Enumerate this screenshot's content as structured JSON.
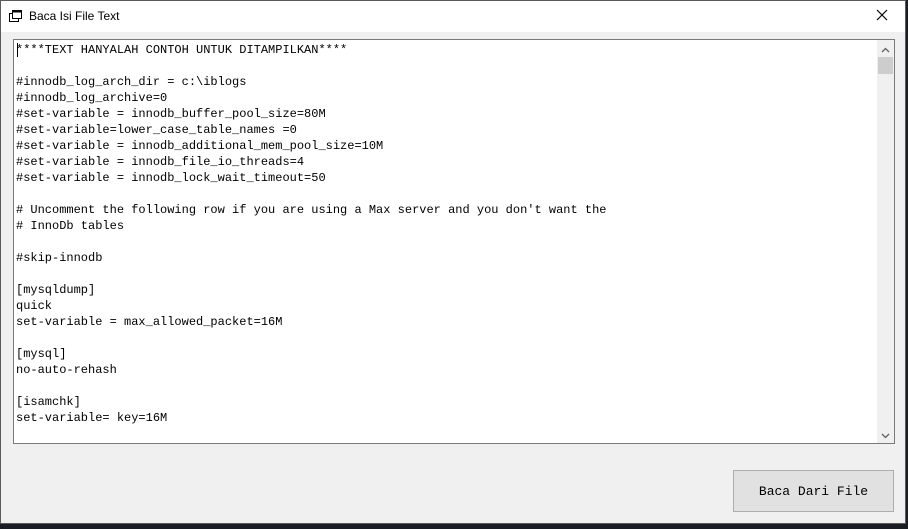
{
  "window": {
    "title": "Baca Isi File Text"
  },
  "editor": {
    "content": "****TEXT HANYALAH CONTOH UNTUK DITAMPILKAN****\n\n#innodb_log_arch_dir = c:\\iblogs\n#innodb_log_archive=0\n#set-variable = innodb_buffer_pool_size=80M\n#set-variable=lower_case_table_names =0\n#set-variable = innodb_additional_mem_pool_size=10M\n#set-variable = innodb_file_io_threads=4\n#set-variable = innodb_lock_wait_timeout=50\n\n# Uncomment the following row if you are using a Max server and you don't want the\n# InnoDb tables\n\n#skip-innodb\n\n[mysqldump]\nquick\nset-variable = max_allowed_packet=16M\n\n[mysql]\nno-auto-rehash\n\n[isamchk]\nset-variable= key=16M"
  },
  "buttons": {
    "read_file": "Baca Dari File"
  }
}
